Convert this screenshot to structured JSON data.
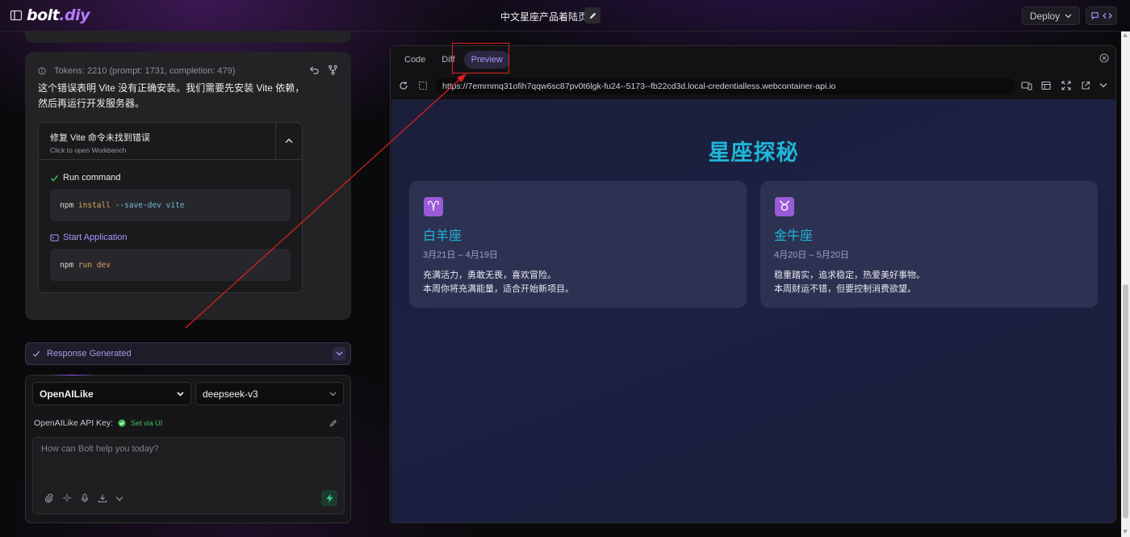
{
  "header": {
    "logo_main": "bolt",
    "logo_accent": ".diy",
    "project_title": "中文星座产品着陆页",
    "deploy_label": "Deploy"
  },
  "chat": {
    "tokens_text": "Tokens: 2210 (prompt: 1731, completion: 479)",
    "message_text": "这个错误表明 Vite 没有正确安装。我们需要先安装 Vite 依赖，然后再运行开发服务器。",
    "artifact": {
      "title": "修复 Vite 命令未找到错误",
      "subtitle": "Click to open Workbench",
      "actions": [
        {
          "label": "Run command",
          "code_cmd": "npm",
          "code_args": "install",
          "code_flag": "--save-dev vite"
        },
        {
          "label": "Start Application",
          "code_cmd": "npm",
          "code_args": "run dev",
          "code_flag": ""
        }
      ]
    },
    "response_status": "Response Generated"
  },
  "input": {
    "provider": "OpenAILike",
    "model": "deepseek-v3",
    "api_key_label": "OpenAILike API Key:",
    "api_key_status": "Set via UI",
    "placeholder": "How can Bolt help you today?"
  },
  "workbench": {
    "tabs": [
      {
        "label": "Code",
        "active": false
      },
      {
        "label": "Diff",
        "active": false
      },
      {
        "label": "Preview",
        "active": true
      }
    ],
    "url": "https://7emrnmq31ofih7qqw6sc87pv0t6lgk-fu24--5173--fb22cd3d.local-credentialless.webcontainer-api.io"
  },
  "preview": {
    "title": "星座探秘",
    "cards": [
      {
        "symbol": "♈",
        "name": "白羊座",
        "date": "3月21日 – 4月19日",
        "line1": "充满活力，勇敢无畏，喜欢冒险。",
        "line2": "本周你将充满能量，适合开始新项目。"
      },
      {
        "symbol": "♉",
        "name": "金牛座",
        "date": "4月20日 – 5月20日",
        "line1": "稳重踏实，追求稳定，热爱美好事物。",
        "line2": "本周财运不错，但要控制消费欲望。"
      }
    ]
  },
  "colors": {
    "accent": "#a995ff",
    "preview_heading": "#1fb6d8",
    "annotation": "#e02020",
    "success": "#3fc15b"
  }
}
